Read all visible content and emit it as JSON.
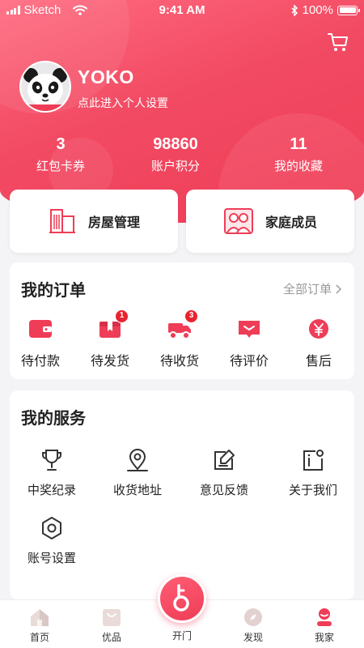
{
  "status_bar": {
    "carrier": "Sketch",
    "time": "9:41 AM",
    "battery": "100%"
  },
  "profile": {
    "name": "YOKO",
    "subtitle": "点此进入个人设置"
  },
  "stats": [
    {
      "value": "3",
      "label": "红包卡券"
    },
    {
      "value": "98860",
      "label": "账户积分"
    },
    {
      "value": "11",
      "label": "我的收藏"
    }
  ],
  "management": [
    {
      "label": "房屋管理",
      "icon": "building-icon"
    },
    {
      "label": "家庭成员",
      "icon": "family-icon"
    }
  ],
  "orders": {
    "title": "我的订单",
    "all_link": "全部订单",
    "items": [
      {
        "label": "待付款",
        "icon": "wallet-icon",
        "badge": ""
      },
      {
        "label": "待发货",
        "icon": "package-icon",
        "badge": "1"
      },
      {
        "label": "待收货",
        "icon": "truck-icon",
        "badge": "3"
      },
      {
        "label": "待评价",
        "icon": "comment-icon",
        "badge": ""
      },
      {
        "label": "售后",
        "icon": "yen-refund-icon",
        "badge": ""
      }
    ]
  },
  "services": {
    "title": "我的服务",
    "items": [
      {
        "label": "中奖纪录",
        "icon": "trophy-icon"
      },
      {
        "label": "收货地址",
        "icon": "location-icon"
      },
      {
        "label": "意见反馈",
        "icon": "feedback-icon"
      },
      {
        "label": "关于我们",
        "icon": "info-icon"
      },
      {
        "label": "账号设置",
        "icon": "settings-icon"
      }
    ]
  },
  "tabbar": {
    "items": [
      {
        "label": "首页",
        "icon": "home-icon"
      },
      {
        "label": "优品",
        "icon": "shopping-bag-icon"
      },
      {
        "label": "开门",
        "icon": "key-icon"
      },
      {
        "label": "发现",
        "icon": "compass-icon"
      },
      {
        "label": "我家",
        "icon": "user-icon"
      }
    ],
    "active": "我家"
  },
  "colors": {
    "accent": "#ef3d57",
    "accent_light": "#ff6b80",
    "background": "#f4f4f6"
  }
}
